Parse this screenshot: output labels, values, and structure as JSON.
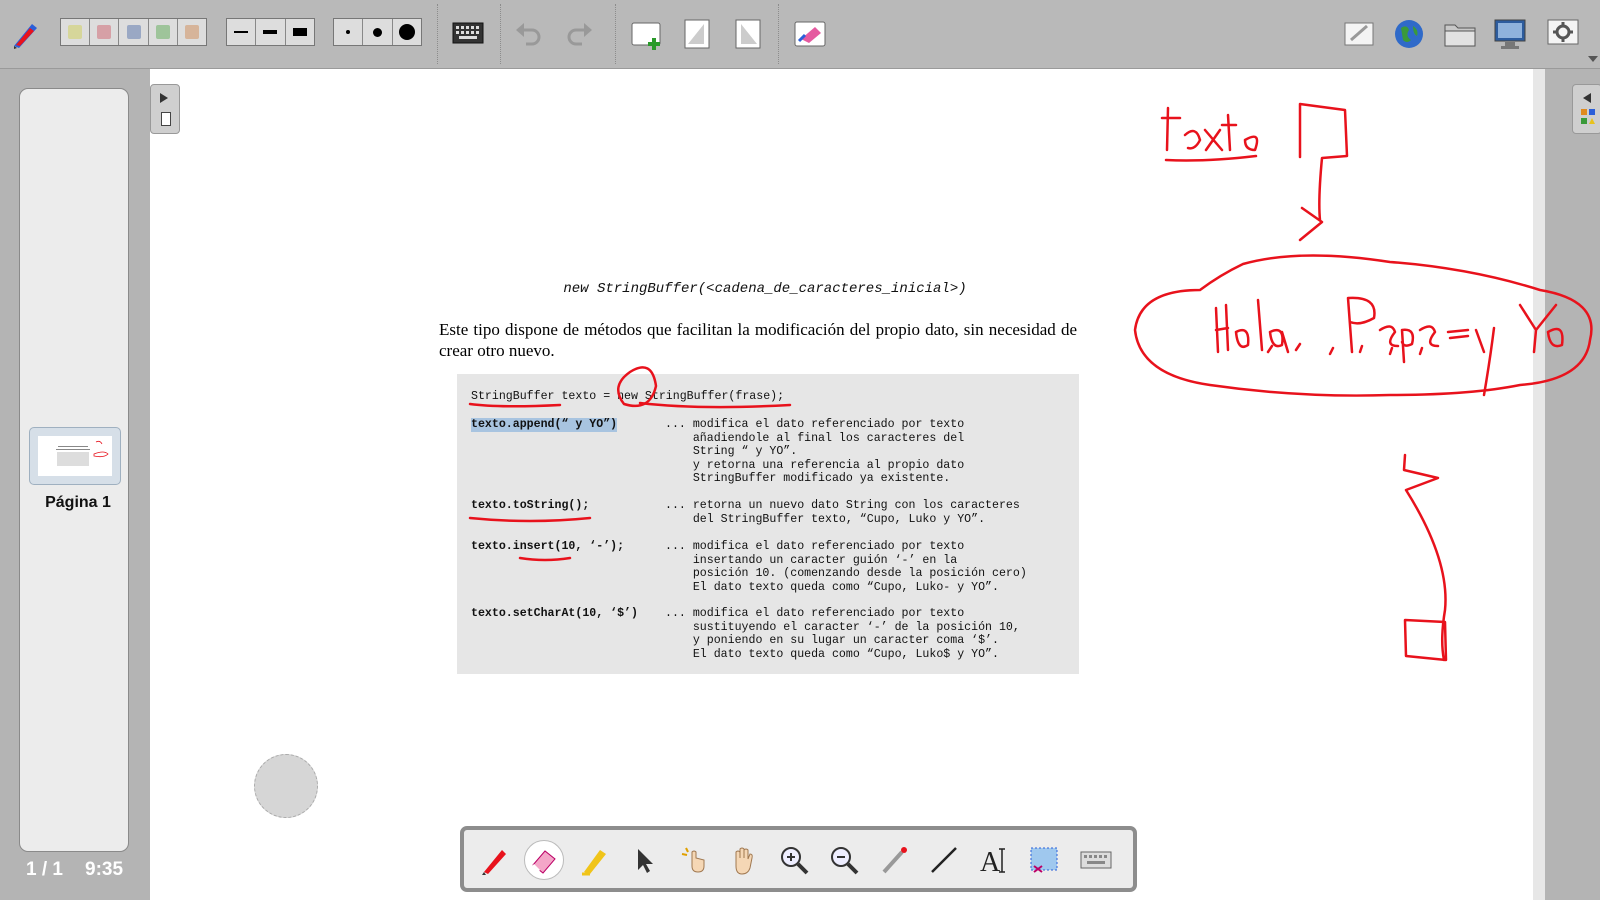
{
  "document": {
    "constructor_line": "new StringBuffer(<cadena_de_caracteres_inicial>)",
    "paragraph": "Este tipo dispone de métodos que facilitan la modificación del propio dato, sin necesidad de crear otro nuevo.",
    "code_decl": "StringBuffer texto = new StringBuffer(frase);",
    "methods": [
      {
        "sig": "texto.append(“ y YO”)",
        "desc": [
          "... modifica el dato referenciado por texto",
          "    añadiendole al final los caracteres del",
          "    String “ y YO”.",
          "    y retorna una referencia al propio dato",
          "    StringBuffer modificado ya existente."
        ]
      },
      {
        "sig": "texto.toString();",
        "desc": [
          "... retorna un nuevo dato String con los caracteres",
          "    del StringBuffer texto, “Cupo, Luko y YO”."
        ]
      },
      {
        "sig": "texto.insert(10, ‘-’);",
        "desc": [
          "... modifica el dato referenciado por texto",
          "    insertando un caracter guión ‘-’ en la",
          "    posición 10. (comenzando desde la posición cero)",
          "    El dato texto queda como “Cupo, Luko- y YO”."
        ]
      },
      {
        "sig": "texto.setCharAt(10, ‘$’)",
        "desc": [
          "... modifica el dato referenciado por texto",
          "    sustituyendo el caracter ‘-’ de la posición 10,",
          "    y poniendo en su lugar un caracter coma ‘$’.",
          "    El dato texto queda como “Cupo, Luko$ y YO”."
        ]
      }
    ]
  },
  "sidebar": {
    "page_label": "Página 1",
    "page_count": "1 / 1",
    "clock": "9:35"
  },
  "ink_color": "#e8121c",
  "toolbar_icons": [
    "pen-tool-icon",
    "color-palette",
    "line-width",
    "dot-size",
    "keyboard-icon",
    "undo-icon",
    "redo-icon",
    "new-page-icon",
    "prev-page-icon",
    "next-page-icon",
    "erase-board-icon",
    "notepad-icon",
    "web-icon",
    "folder-icon",
    "desktop-icon",
    "settings-icon"
  ],
  "tool_palette_icons": [
    "pen-icon",
    "eraser-icon",
    "marker-icon",
    "selector-icon",
    "interact-icon",
    "hand-icon",
    "zoom-in-icon",
    "zoom-out-icon",
    "laser-pointer-icon",
    "line-icon",
    "text-icon",
    "capture-icon",
    "virtual-keyboard-icon"
  ]
}
